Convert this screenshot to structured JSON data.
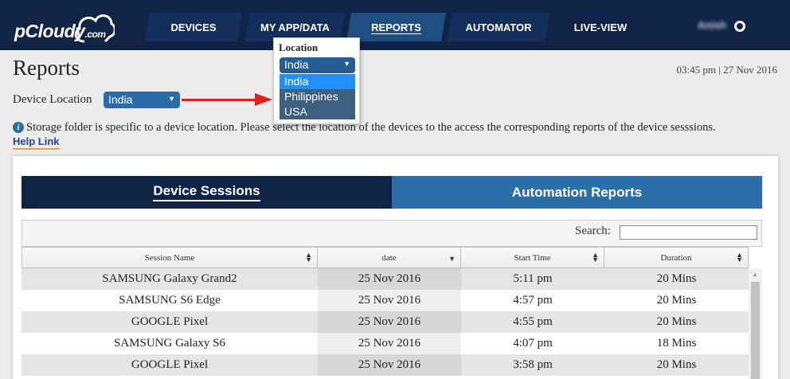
{
  "brand": {
    "name": "pCloudy",
    "suffix": ".com"
  },
  "nav": {
    "tabs": [
      {
        "label": "DEVICES"
      },
      {
        "label": "MY APP/DATA"
      },
      {
        "label": "REPORTS"
      },
      {
        "label": "AUTOMATOR"
      },
      {
        "label": "LIVE-VIEW"
      }
    ],
    "active_tab": "REPORTS",
    "user_name": "Anish"
  },
  "page": {
    "title": "Reports",
    "timestamp": "03:45 pm | 27 Nov 2016",
    "device_location_label": "Device Location",
    "device_location_value": "India",
    "info_text": "Storage folder is specific to a device location. Please select the location of the devices to the access the corresponding reports of the device sesssions.",
    "help_link": "Help Link"
  },
  "location_popup": {
    "title": "Location",
    "selected": "India",
    "options": [
      "India",
      "Philippines",
      "USA"
    ]
  },
  "report_tabs": {
    "sessions": "Device Sessions",
    "automation": "Automation Reports"
  },
  "table": {
    "search_label": "Search:",
    "search_value": "",
    "columns": [
      "Session Name",
      "date",
      "Start Time",
      "Duration"
    ],
    "rows": [
      [
        "SAMSUNG Galaxy Grand2",
        "25 Nov 2016",
        "5:11 pm",
        "20 Mins"
      ],
      [
        "SAMSUNG S6 Edge",
        "25 Nov 2016",
        "4:57 pm",
        "20 Mins"
      ],
      [
        "GOOGLE Pixel",
        "25 Nov 2016",
        "4:55 pm",
        "20 Mins"
      ],
      [
        "SAMSUNG Galaxy S6",
        "25 Nov 2016",
        "4:07 pm",
        "18 Mins"
      ],
      [
        "GOOGLE Pixel",
        "25 Nov 2016",
        "3:58 pm",
        "20 Mins"
      ]
    ]
  },
  "colors": {
    "nav_background": "#0f2446",
    "accent_blue": "#2c6fa8",
    "arrow_red": "#e0211b",
    "help_underline": "#e7a33b"
  }
}
